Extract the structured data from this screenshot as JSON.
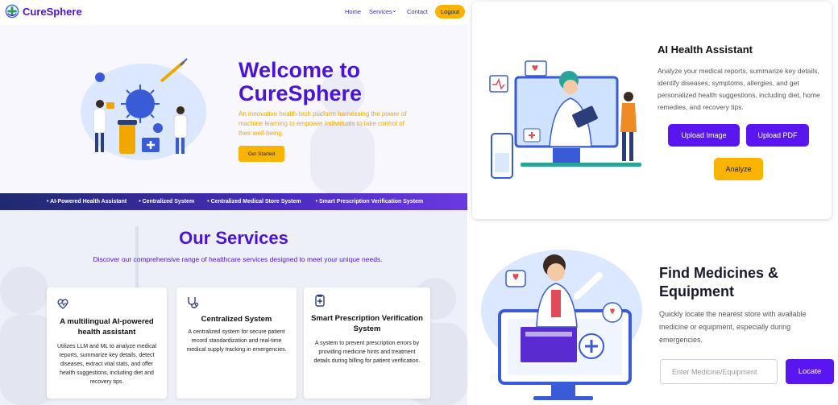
{
  "nav": {
    "brand": "CureSphere",
    "links": [
      "Home",
      "Services",
      "Contact"
    ],
    "services_caret": "⌄",
    "logout_label": "Logout"
  },
  "hero": {
    "title": "Welcome to CureSphere",
    "description": "An innovative health-tech platform harnessing the power of machine learning to empower individuals to take control of their well-being.",
    "cta_label": "Get Started"
  },
  "ticker": {
    "items": [
      "• AI-Powered Health Assistant",
      "• Centralized System",
      "• Centralized Medical Store System",
      "• Smart Prescription Verification System"
    ]
  },
  "services": {
    "title": "Our Services",
    "subtitle": "Discover our comprehensive range of healthcare services designed to meet your unique needs.",
    "cards": [
      {
        "icon": "heart-pulse-icon",
        "title": "A multilingual AI-powered health assistant",
        "text": "Utilizes LLM and ML to analyze medical reports, summarize key details, detect diseases, extract vital stats, and offer health suggestions, including diet and recovery tips."
      },
      {
        "icon": "stethoscope-icon",
        "title": "Centralized System",
        "text": "A centralized system for secure patient record standardization and real-time medical supply tracking in emergencies."
      },
      {
        "icon": "prescription-icon",
        "title": "Smart Prescription Verification System",
        "text": "A system to prevent prescription errors by providing medicine hints and treatment details during billing for patient verification."
      }
    ]
  },
  "ai_assistant": {
    "title": "AI Health Assistant",
    "description": "Analyze your medical reports, summarize key details, identify diseases, symptoms, allergies, and get personalized health suggestions, including diet, home remedies, and recovery tips.",
    "upload_image_label": "Upload Image",
    "upload_pdf_label": "Upload PDF",
    "analyze_label": "Analyze"
  },
  "find_medicines": {
    "title": "Find Medicines & Equipment",
    "description": "Quickly locate the nearest store with available medicine or equipment, especially during emergencies.",
    "input_placeholder": "Enter Medicine/Equipment",
    "locate_label": "Locate"
  },
  "colors": {
    "brand_purple": "#4a14d6",
    "button_purple": "#5a16f0",
    "accent_yellow": "#f8b400"
  }
}
